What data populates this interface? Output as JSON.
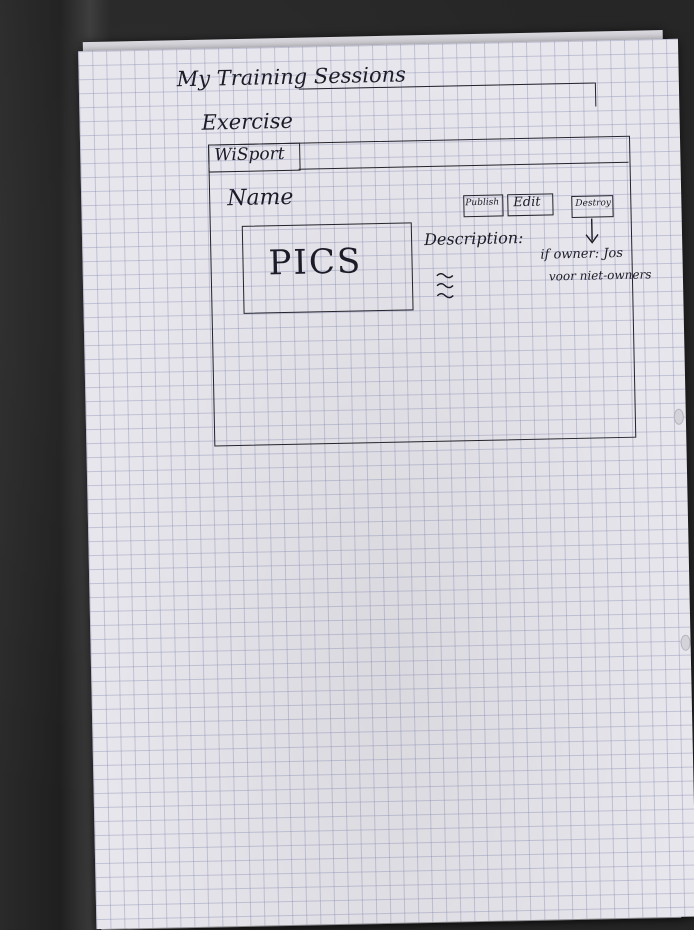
{
  "sketch": {
    "page_title": "My Training Sessions",
    "section": "Exercise",
    "app_name": "WiSport",
    "name_label": "Name",
    "pics_label": "PICS",
    "description_label": "Description:",
    "buttons": {
      "publish": "Publish",
      "edit": "Edit",
      "destroy": "Destroy"
    },
    "note_line1": "if owner: Jos",
    "note_line2": "voor niet-owners"
  }
}
